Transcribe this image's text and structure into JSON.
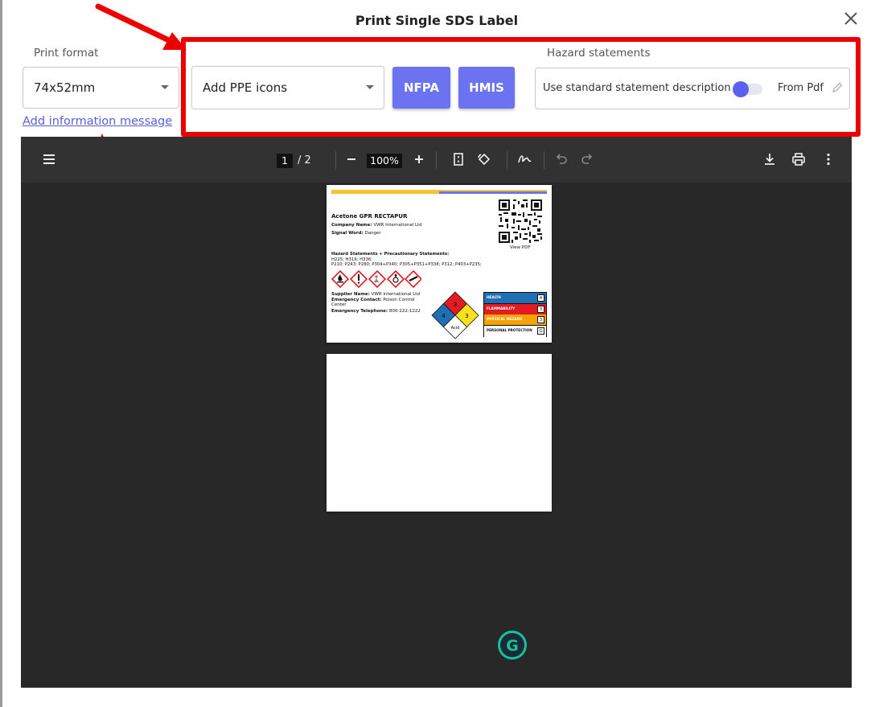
{
  "modal": {
    "title": "Print Single SDS Label"
  },
  "print_format": {
    "label": "Print format",
    "value": "74x52mm"
  },
  "ppe": {
    "value": "Add PPE icons"
  },
  "buttons": {
    "nfpa": "NFPA",
    "hmis": "HMIS"
  },
  "info_link": "Add information message",
  "hazard": {
    "label": "Hazard statements",
    "description": "Use standard statement description",
    "toggle_on": true,
    "source": "From Pdf"
  },
  "viewer": {
    "current_page": "1",
    "total_pages": "/ 2",
    "zoom": "100%"
  },
  "sds_label": {
    "product": "Acetone GPR RECTAPUR",
    "company_label": "Company Name:",
    "company_value": "VWR International Ltd",
    "signal_label": "Signal Word:",
    "signal_value": "Danger",
    "qr_caption": "View PDF",
    "statements_heading": "Hazard Statements + Precautionary Statements:",
    "statements_line1": "H225; H319; H336;",
    "statements_line2": "P210; P243; P280; P304+P340; P305+P351+P338; P312; P403+P235;",
    "supplier_label": "Supplier Name:",
    "supplier_value": "VWR International Ltd",
    "emergency_contact_label": "Emergency Contact:",
    "emergency_contact_value": "Poison Control",
    "emergency_contact_value2": "Center",
    "emergency_phone_label": "Emergency Telephone:",
    "emergency_phone_value": "800-222-1222",
    "nfpa": {
      "health": "4",
      "flammability": "3",
      "instability": "3",
      "special": "Acid"
    },
    "hmis": [
      {
        "name": "HEALTH",
        "value": "4",
        "color": "#1f6fb5"
      },
      {
        "name": "FLAMMABILITY",
        "value": "3",
        "color": "#e31b23"
      },
      {
        "name": "PHYSICAL HAZARD",
        "value": "3",
        "color": "#f5a300"
      },
      {
        "name": "PERSONAL PROTECTION",
        "value": "G",
        "color": "#ffffff"
      }
    ]
  },
  "colors": {
    "accent": "#6b73f0",
    "annotation": "#ee0000",
    "label_bar_yellow": "#f7c431",
    "label_bar_blue": "#6b73f0"
  }
}
